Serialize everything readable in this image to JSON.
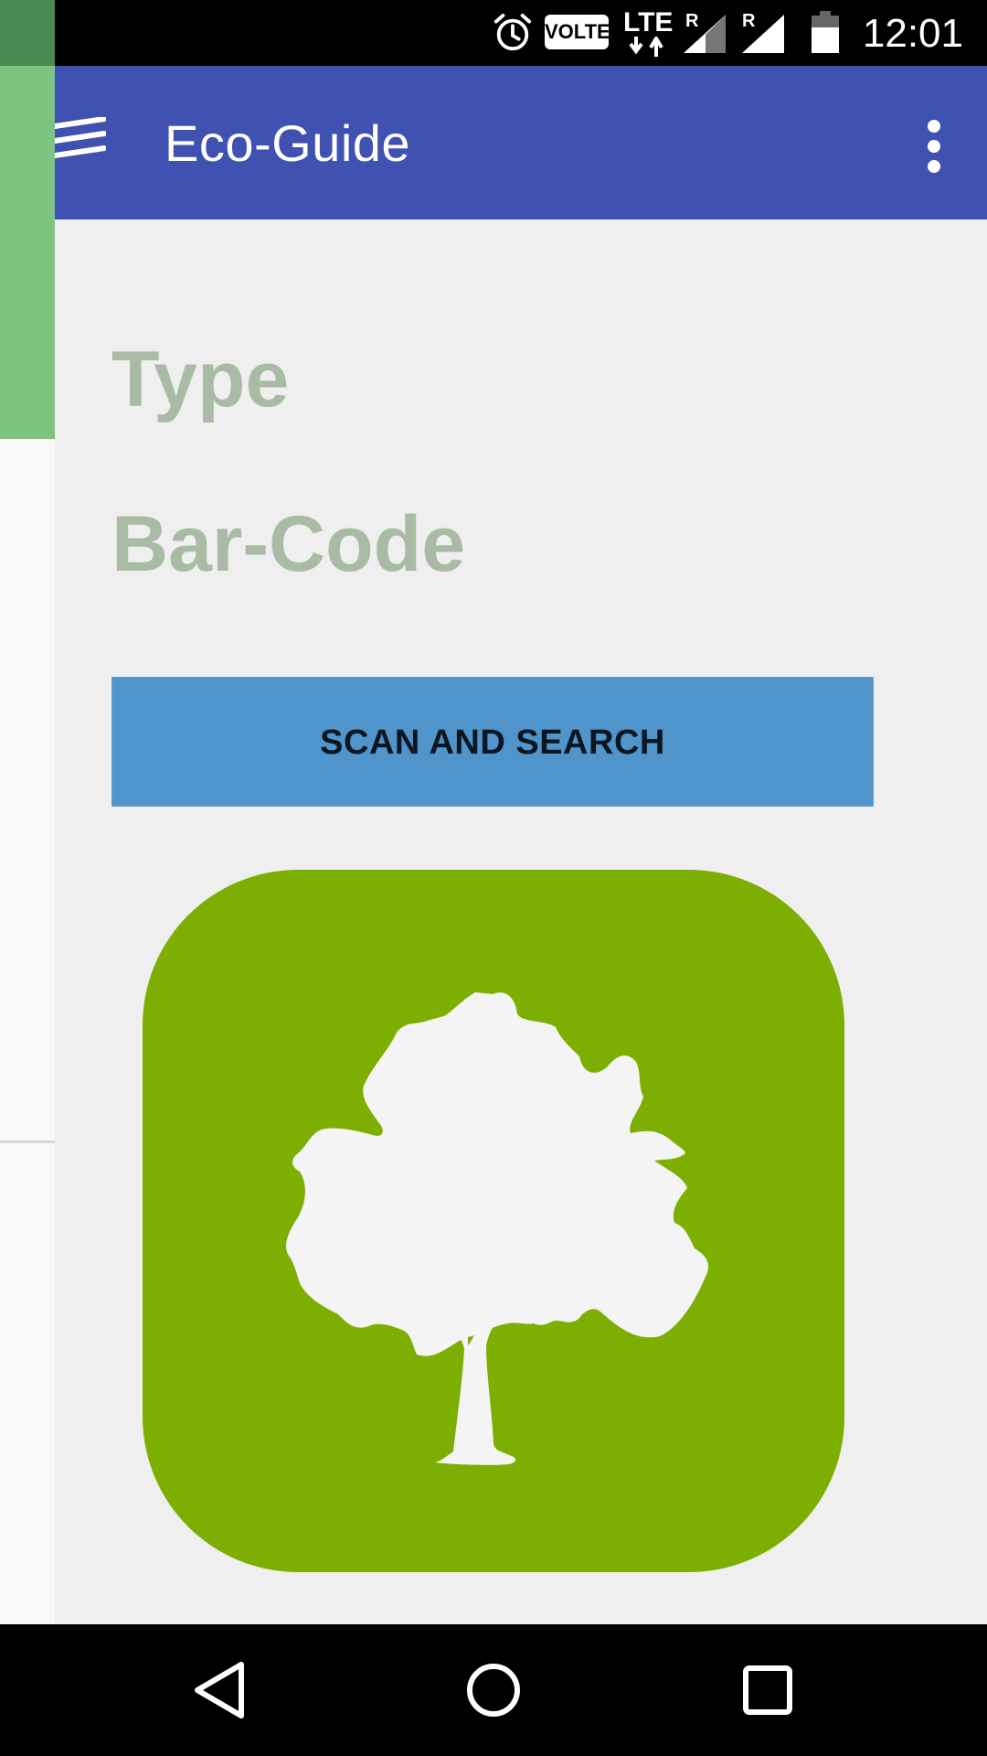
{
  "status_bar": {
    "time": "12:01",
    "volte": "VOLTE",
    "network": "LTE",
    "roaming_1": "R",
    "roaming_2": "R",
    "icons": [
      "alarm-icon",
      "volte-badge",
      "lte-icon",
      "signal-icon",
      "signal-icon",
      "battery-icon"
    ]
  },
  "app_bar": {
    "title": "Eco-Guide",
    "menu_icon": "hamburger-icon",
    "overflow_icon": "more-vert-icon",
    "color": "#3f51b1"
  },
  "main": {
    "type_label": "Type",
    "barcode_label": "Bar-Code",
    "scan_button_label": "SCAN AND SEARCH",
    "tree_icon": "tree-icon",
    "tile_color": "#7daf02",
    "button_color": "#4f94cb"
  },
  "nav_bar": {
    "back_icon": "back-icon",
    "home_icon": "home-icon",
    "recents_icon": "recents-icon"
  }
}
